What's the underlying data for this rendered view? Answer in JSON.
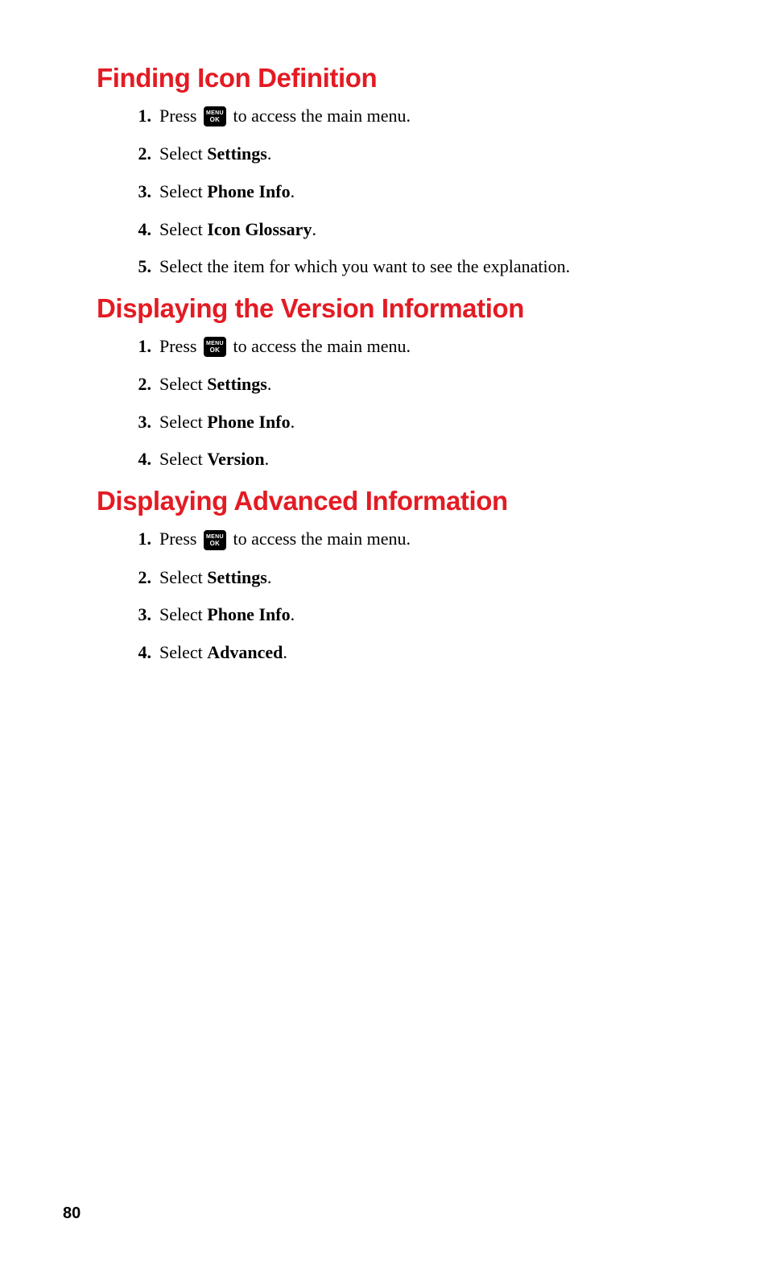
{
  "page_number": "80",
  "sections": [
    {
      "title": "Finding Icon Definition",
      "steps": [
        {
          "num": "1.",
          "pre": "Press ",
          "icon": true,
          "post": " to access the main menu."
        },
        {
          "num": "2.",
          "pre": "Select ",
          "bold": "Settings",
          "post": "."
        },
        {
          "num": "3.",
          "pre": "Select ",
          "bold": "Phone Info",
          "post": "."
        },
        {
          "num": "4.",
          "pre": "Select ",
          "bold": "Icon Glossary",
          "post": "."
        },
        {
          "num": "5.",
          "pre": "Select the item for which you want to see the explanation."
        }
      ]
    },
    {
      "title": "Displaying the Version Information",
      "steps": [
        {
          "num": "1.",
          "pre": "Press ",
          "icon": true,
          "post": " to access the main menu."
        },
        {
          "num": "2.",
          "pre": "Select ",
          "bold": "Settings",
          "post": "."
        },
        {
          "num": "3.",
          "pre": "Select ",
          "bold": "Phone Info",
          "post": "."
        },
        {
          "num": "4.",
          "pre": "Select ",
          "bold": "Version",
          "post": "."
        }
      ]
    },
    {
      "title": "Displaying Advanced Information",
      "steps": [
        {
          "num": "1.",
          "pre": "Press ",
          "icon": true,
          "post": " to access the main menu."
        },
        {
          "num": "2.",
          "pre": "Select ",
          "bold": "Settings",
          "post": "."
        },
        {
          "num": "3.",
          "pre": "Select ",
          "bold": "Phone Info",
          "post": "."
        },
        {
          "num": "4.",
          "pre": "Select ",
          "bold": "Advanced",
          "post": "."
        }
      ]
    }
  ],
  "icon_label": {
    "line1": "MENU",
    "line2": "OK"
  }
}
